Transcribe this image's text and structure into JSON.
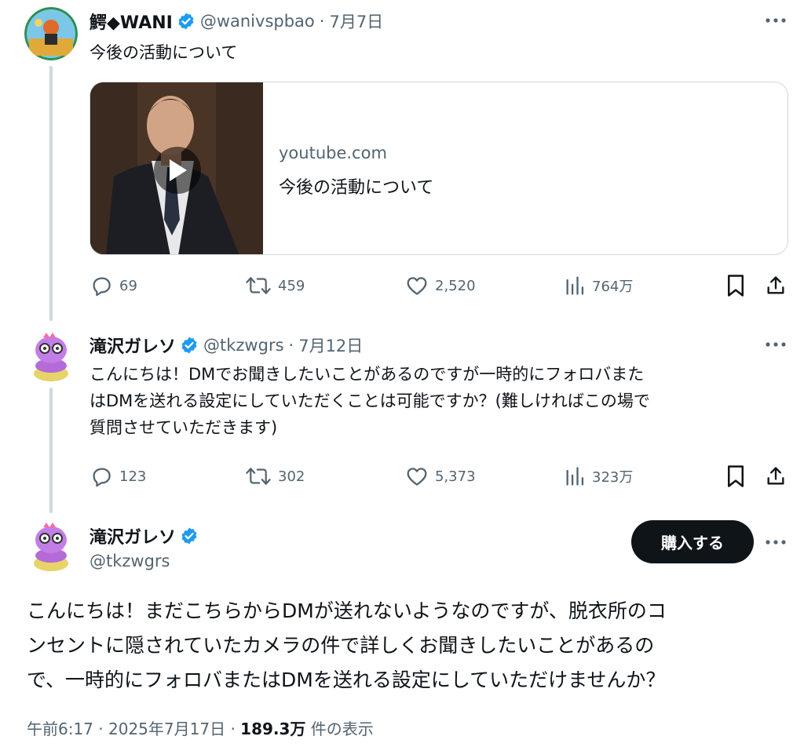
{
  "tweets": [
    {
      "display_name": "鰐◆WANI",
      "handle": "@wanivspbao",
      "sep": "·",
      "time": "7月7日",
      "text": "今後の活動について",
      "card": {
        "domain": "youtube.com",
        "title": "今後の活動について"
      },
      "stats": {
        "replies": "69",
        "retweets": "459",
        "likes": "2,520",
        "views": "764万"
      }
    },
    {
      "display_name": "滝沢ガレソ",
      "handle": "@tkzwgrs",
      "sep": "·",
      "time": "7月12日",
      "text_lines": [
        "こんにちは！DMでお聞きしたいことがあるのですが一時的にフォロバまた",
        "はDMを送れる設定にしていただくことは可能ですか？(難しければこの場で",
        "質問させていただきます)"
      ],
      "stats": {
        "replies": "123",
        "retweets": "302",
        "likes": "5,373",
        "views": "323万"
      }
    }
  ],
  "main_tweet": {
    "display_name": "滝沢ガレソ",
    "handle": "@tkzwgrs",
    "buy_button": "購入する",
    "text_lines": [
      "こんにちは！まだこちらからDMが送れないようなのですが、脱衣所のコ",
      "ンセントに隠されていたカメラの件で詳しくお聞きしたいことがあるの",
      "で、一時的にフォロバまたはDMを送れる設定にしていただけませんか？"
    ],
    "time": "午前6:17",
    "sep": "·",
    "date": "2025年7月17日",
    "views_count": "189.3万",
    "views_label": "件の表示"
  },
  "colors": {
    "text": "#0f1419",
    "muted": "#536471",
    "border": "#cfd9de",
    "verified": "#1d9bf0"
  },
  "icons": [
    "verified-badge-icon",
    "more-icon",
    "reply-icon",
    "retweet-icon",
    "like-icon",
    "views-icon",
    "bookmark-icon",
    "share-icon",
    "play-icon"
  ]
}
